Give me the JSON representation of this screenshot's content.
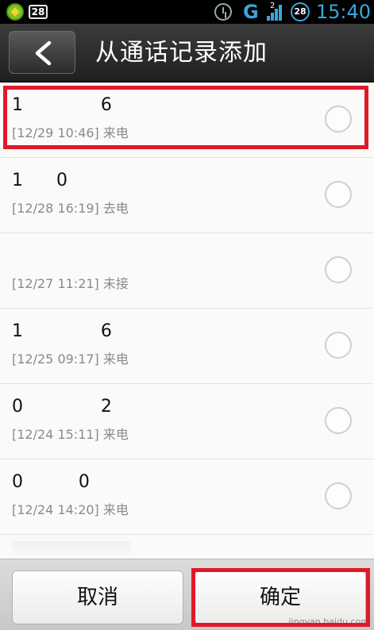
{
  "status_bar": {
    "badge": "28",
    "network": "G",
    "network_sup": "2",
    "battery": "28",
    "time": "15:40",
    "icons": [
      "app-icon",
      "notification-badge-icon",
      "alarm-icon",
      "signal-icon",
      "battery-icon"
    ]
  },
  "header": {
    "back_icon": "chevron-left-icon",
    "title": "从通话记录添加"
  },
  "calls": [
    {
      "name": "1              6",
      "meta": "[12/29 10:46] 来电",
      "selected": false
    },
    {
      "name": "1      0",
      "meta": "[12/28 16:19] 去电",
      "selected": false
    },
    {
      "name": "",
      "meta": "[12/27 11:21] 未接",
      "selected": false
    },
    {
      "name": "1              6",
      "meta": "[12/25 09:17] 来电",
      "selected": false
    },
    {
      "name": "0              2",
      "meta": "[12/24 15:11] 来电",
      "selected": false
    },
    {
      "name": "0          0",
      "meta": "[12/24 14:20] 来电",
      "selected": false
    }
  ],
  "footer": {
    "cancel_label": "取消",
    "confirm_label": "确定",
    "watermark": "jingyan.baidu.com"
  },
  "colors": {
    "accent": "#3aa6dd",
    "highlight": "#e0192a",
    "title_bg": "#2a2a2a"
  }
}
